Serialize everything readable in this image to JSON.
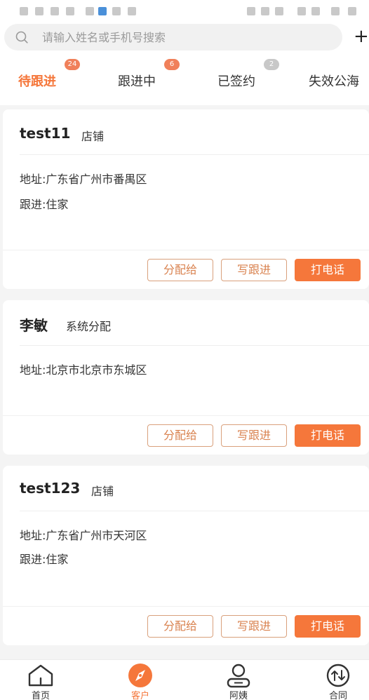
{
  "search": {
    "placeholder": "请输入姓名或手机号搜索"
  },
  "header": {
    "add_label": "+"
  },
  "tabs": [
    {
      "label": "待跟进",
      "badge": "24",
      "active": true
    },
    {
      "label": "跟进中",
      "badge": "6",
      "active": false
    },
    {
      "label": "已签约",
      "badge": "2",
      "active": false
    },
    {
      "label": "失效公海",
      "badge": "",
      "active": false
    }
  ],
  "cards": [
    {
      "name": "test11",
      "tag": "店铺",
      "lines": [
        "地址:广东省广州市番禺区",
        "跟进:住家"
      ],
      "actions": {
        "assign": "分配给",
        "follow": "写跟进",
        "call": "打电话"
      }
    },
    {
      "name": "李敏",
      "tag": "系统分配",
      "lines": [
        "地址:北京市北京市东城区"
      ],
      "actions": {
        "assign": "分配给",
        "follow": "写跟进",
        "call": "打电话"
      }
    },
    {
      "name": "test123",
      "tag": "店铺",
      "lines": [
        "地址:广东省广州市天河区",
        "跟进:住家"
      ],
      "actions": {
        "assign": "分配给",
        "follow": "写跟进",
        "call": "打电话"
      }
    }
  ],
  "nav": [
    {
      "label": "首页",
      "icon": "home-icon",
      "active": false
    },
    {
      "label": "客户",
      "icon": "compass-icon",
      "active": true
    },
    {
      "label": "阿姨",
      "icon": "person-icon",
      "active": false
    },
    {
      "label": "合同",
      "icon": "swap-circle-icon",
      "active": false
    }
  ],
  "colors": {
    "accent": "#f5773b",
    "badge": "#f0805a",
    "badge_inactive": "#c8c8c8"
  }
}
